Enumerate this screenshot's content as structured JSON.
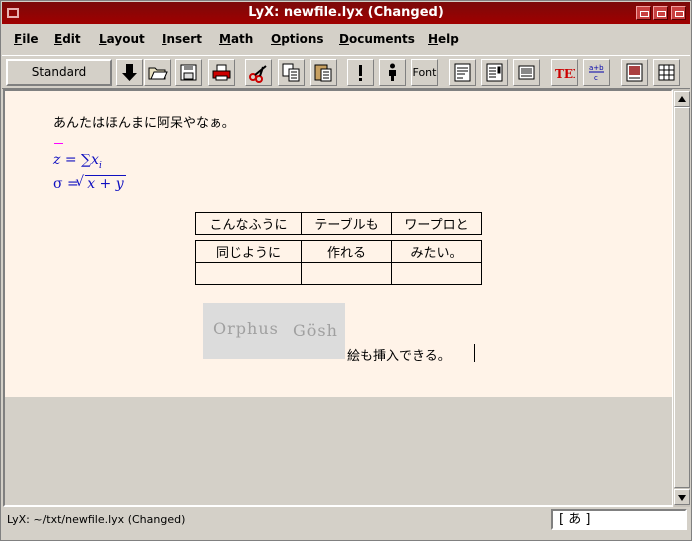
{
  "window": {
    "title": "LyX: newfile.lyx (Changed)"
  },
  "menu": {
    "items": [
      "File",
      "Edit",
      "Layout",
      "Insert",
      "Math",
      "Options",
      "Documents",
      "Help"
    ]
  },
  "toolbar": {
    "layout_value": "Standard",
    "font_label": "Font",
    "buttons": [
      "depth-down-icon",
      "open-icon",
      "save-icon",
      "print-icon",
      "cut-icon",
      "copy-icon",
      "paste-icon",
      "exclamation-icon",
      "person-icon",
      "font-icon",
      "footnote-icon",
      "margin-note-icon",
      "figure-icon",
      "tex-icon",
      "math-frac-icon",
      "float-icon",
      "table-icon"
    ]
  },
  "document": {
    "line1": "あんたはほんまに阿呆やなぁ。",
    "math1": {
      "lhs": "z",
      "eq": "=",
      "sum": "∑",
      "var": "x",
      "sub": "i"
    },
    "math2": {
      "lhs": "σ",
      "eq": "=",
      "radicand": "x + y"
    },
    "table1": [
      [
        "こんなふうに",
        "テーブルも",
        "ワープロと"
      ]
    ],
    "table2": [
      [
        "同じように",
        "作れる",
        "みたい。"
      ],
      [
        "",
        "",
        ""
      ]
    ],
    "graphic_text": [
      "Orphus",
      "Gösh"
    ],
    "line2": "絵も挿入できる。"
  },
  "statusbar": {
    "text": "LyX: ~/txt/newfile.lyx (Changed)",
    "ime": "[ あ ]"
  },
  "colors": {
    "titlebar": "#a00000",
    "document_bg": "#fff3e8",
    "math": "#1010c0"
  }
}
